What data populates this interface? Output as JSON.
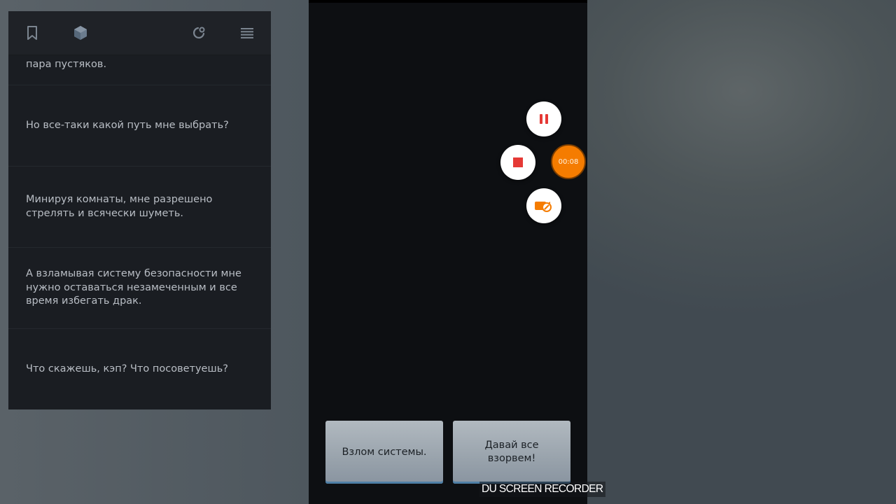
{
  "toolbar": {
    "bookmark_icon": "bookmark-icon",
    "cube_icon": "cube-icon",
    "refresh_icon": "refresh-icon",
    "menu_icon": "menu-icon"
  },
  "messages": [
    {
      "text": "пара пустяков."
    },
    {
      "text": "Но все-таки какой путь мне выбрать?"
    },
    {
      "text": "Минируя комнаты, мне разрешено стрелять и всячески шуметь."
    },
    {
      "text": "А взламывая систему безопасности мне нужно оставаться незамеченным и все время избегать драк."
    },
    {
      "text": "Что скажешь, кэп? Что посоветуешь?"
    }
  ],
  "choices": [
    {
      "label": "Взлом системы."
    },
    {
      "label": "Давай все взорвем!"
    }
  ],
  "recorder": {
    "timer": "00:08",
    "watermark": "DU SCREEN RECORDER",
    "accent_color": "#f57c00",
    "control_color": "#e53935"
  }
}
